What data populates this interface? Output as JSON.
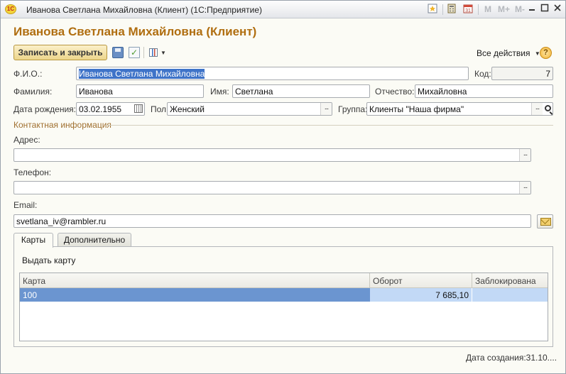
{
  "window": {
    "title": "Иванова Светлана Михайловна (Клиент)  (1С:Предприятие)",
    "logo_text": "1С",
    "m_buttons": [
      "M",
      "M+",
      "M-"
    ]
  },
  "form": {
    "title": "Иванова Светлана Михайловна (Клиент)"
  },
  "toolbar": {
    "save_close_label": "Записать и закрыть",
    "all_actions_label": "Все действия",
    "help_label": "?"
  },
  "fields": {
    "fio_label": "Ф.И.О.:",
    "fio_value": "Иванова Светлана Михайловна",
    "code_label": "Код:",
    "code_value": "7",
    "lastname_label": "Фамилия:",
    "lastname_value": "Иванова",
    "firstname_label": "Имя:",
    "firstname_value": "Светлана",
    "patronymic_label": "Отчество:",
    "patronymic_value": "Михайловна",
    "birthdate_label": "Дата рождения:",
    "birthdate_value": "03.02.1955",
    "gender_label": "Пол:",
    "gender_value": "Женский",
    "group_label": "Группа:",
    "group_value": "Клиенты \"Наша фирма\""
  },
  "contact": {
    "group_title": "Контактная информация",
    "address_label": "Адрес:",
    "address_value": "",
    "phone_label": "Телефон:",
    "phone_value": "",
    "email_label": "Email:",
    "email_value": "svetlana_iv@rambler.ru"
  },
  "tabs": [
    {
      "label": "Карты",
      "active": true
    },
    {
      "label": "Дополнительно",
      "active": false
    }
  ],
  "cards": {
    "issue_card_label": "Выдать карту",
    "columns": [
      "Карта",
      "Оборот",
      "Заблокирована"
    ],
    "rows": [
      {
        "card": "100",
        "turnover": "7 685,10",
        "blocked": ""
      }
    ]
  },
  "footer": {
    "created_text": "Дата создания:31.10...."
  },
  "colors": {
    "title_orange": "#b06e10",
    "selection_blue": "#6b95d0",
    "primary_button_gold": "#ecd58b"
  }
}
